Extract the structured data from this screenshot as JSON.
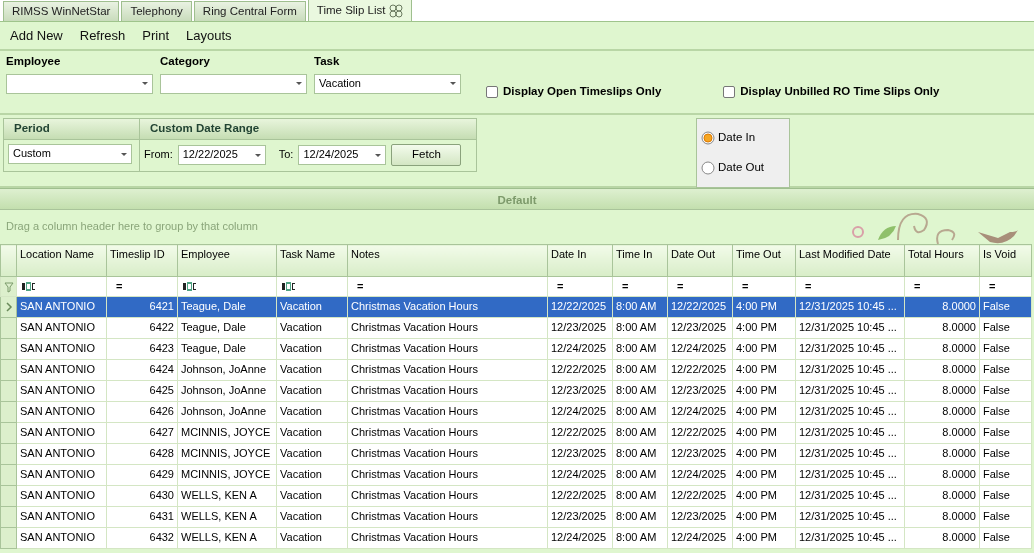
{
  "tabs": [
    {
      "label": "RIMSS WinNetStar",
      "selected": false
    },
    {
      "label": "Telephony",
      "selected": false
    },
    {
      "label": "Ring Central Form",
      "selected": false
    },
    {
      "label": "Time Slip List",
      "selected": true
    }
  ],
  "toolbar": [
    "Add New",
    "Refresh",
    "Print",
    "Layouts"
  ],
  "filters": {
    "fields": [
      {
        "label": "Employee"
      },
      {
        "label": "Category"
      },
      {
        "label": "Task",
        "value": "Vacation"
      }
    ],
    "checkboxes": [
      {
        "label": "Display Open Timeslips Only",
        "checked": false
      },
      {
        "label": "Display Unbilled RO Time Slips Only",
        "checked": false
      }
    ]
  },
  "period": {
    "title": "Period",
    "value": "Custom"
  },
  "date_range": {
    "title": "Custom Date Range",
    "from_label": "From:",
    "from": "12/22/2025",
    "to_label": "To:",
    "to": "12/24/2025",
    "button": "Fetch"
  },
  "date_mode": [
    {
      "label": "Date In",
      "selected": true
    },
    {
      "label": "Date Out",
      "selected": false
    }
  ],
  "grid": {
    "band": "Default",
    "group_hint": "Drag a column header here to group by that column",
    "columns": [
      {
        "label": "Location Name",
        "kind": "text",
        "text_filter": true
      },
      {
        "label": "Timeslip ID",
        "kind": "number",
        "filter": "="
      },
      {
        "label": "Employee",
        "kind": "text",
        "text_filter": true
      },
      {
        "label": "Task Name",
        "kind": "text",
        "text_filter": true
      },
      {
        "label": "Notes",
        "kind": "text",
        "filter": "="
      },
      {
        "label": "Date In",
        "kind": "text",
        "filter": "="
      },
      {
        "label": "Time In",
        "kind": "text",
        "filter": "="
      },
      {
        "label": "Date Out",
        "kind": "text",
        "filter": "="
      },
      {
        "label": "Time Out",
        "kind": "text",
        "filter": "="
      },
      {
        "label": "Last Modified Date",
        "kind": "text",
        "filter": "="
      },
      {
        "label": "Total Hours",
        "kind": "number",
        "filter": "="
      },
      {
        "label": "Is Void",
        "kind": "text",
        "filter": "="
      }
    ],
    "rows": [
      {
        "selected": true,
        "cells": [
          "SAN ANTONIO",
          "6421",
          "Teague, Dale",
          "Vacation",
          "Christmas Vacation Hours",
          "12/22/2025",
          "8:00 AM",
          "12/22/2025",
          "4:00 PM",
          "12/31/2025 10:45 ...",
          "8.0000",
          "False"
        ]
      },
      {
        "selected": false,
        "cells": [
          "SAN ANTONIO",
          "6422",
          "Teague, Dale",
          "Vacation",
          "Christmas Vacation Hours",
          "12/23/2025",
          "8:00 AM",
          "12/23/2025",
          "4:00 PM",
          "12/31/2025 10:45 ...",
          "8.0000",
          "False"
        ]
      },
      {
        "selected": false,
        "cells": [
          "SAN ANTONIO",
          "6423",
          "Teague, Dale",
          "Vacation",
          "Christmas Vacation Hours",
          "12/24/2025",
          "8:00 AM",
          "12/24/2025",
          "4:00 PM",
          "12/31/2025 10:45 ...",
          "8.0000",
          "False"
        ]
      },
      {
        "selected": false,
        "cells": [
          "SAN ANTONIO",
          "6424",
          "Johnson, JoAnne",
          "Vacation",
          "Christmas Vacation Hours",
          "12/22/2025",
          "8:00 AM",
          "12/22/2025",
          "4:00 PM",
          "12/31/2025 10:45 ...",
          "8.0000",
          "False"
        ]
      },
      {
        "selected": false,
        "cells": [
          "SAN ANTONIO",
          "6425",
          "Johnson, JoAnne",
          "Vacation",
          "Christmas Vacation Hours",
          "12/23/2025",
          "8:00 AM",
          "12/23/2025",
          "4:00 PM",
          "12/31/2025 10:45 ...",
          "8.0000",
          "False"
        ]
      },
      {
        "selected": false,
        "cells": [
          "SAN ANTONIO",
          "6426",
          "Johnson, JoAnne",
          "Vacation",
          "Christmas Vacation Hours",
          "12/24/2025",
          "8:00 AM",
          "12/24/2025",
          "4:00 PM",
          "12/31/2025 10:45 ...",
          "8.0000",
          "False"
        ]
      },
      {
        "selected": false,
        "cells": [
          "SAN ANTONIO",
          "6427",
          "MCINNIS, JOYCE",
          "Vacation",
          "Christmas Vacation Hours",
          "12/22/2025",
          "8:00 AM",
          "12/22/2025",
          "4:00 PM",
          "12/31/2025 10:45 ...",
          "8.0000",
          "False"
        ]
      },
      {
        "selected": false,
        "cells": [
          "SAN ANTONIO",
          "6428",
          "MCINNIS, JOYCE",
          "Vacation",
          "Christmas Vacation Hours",
          "12/23/2025",
          "8:00 AM",
          "12/23/2025",
          "4:00 PM",
          "12/31/2025 10:45 ...",
          "8.0000",
          "False"
        ]
      },
      {
        "selected": false,
        "cells": [
          "SAN ANTONIO",
          "6429",
          "MCINNIS, JOYCE",
          "Vacation",
          "Christmas Vacation Hours",
          "12/24/2025",
          "8:00 AM",
          "12/24/2025",
          "4:00 PM",
          "12/31/2025 10:45 ...",
          "8.0000",
          "False"
        ]
      },
      {
        "selected": false,
        "cells": [
          "SAN ANTONIO",
          "6430",
          "WELLS, KEN A",
          "Vacation",
          "Christmas Vacation Hours",
          "12/22/2025",
          "8:00 AM",
          "12/22/2025",
          "4:00 PM",
          "12/31/2025 10:45 ...",
          "8.0000",
          "False"
        ]
      },
      {
        "selected": false,
        "cells": [
          "SAN ANTONIO",
          "6431",
          "WELLS, KEN A",
          "Vacation",
          "Christmas Vacation Hours",
          "12/23/2025",
          "8:00 AM",
          "12/23/2025",
          "4:00 PM",
          "12/31/2025 10:45 ...",
          "8.0000",
          "False"
        ]
      },
      {
        "selected": false,
        "cells": [
          "SAN ANTONIO",
          "6432",
          "WELLS, KEN A",
          "Vacation",
          "Christmas Vacation Hours",
          "12/24/2025",
          "8:00 AM",
          "12/24/2025",
          "4:00 PM",
          "12/31/2025 10:45 ...",
          "8.0000",
          "False"
        ]
      }
    ]
  }
}
